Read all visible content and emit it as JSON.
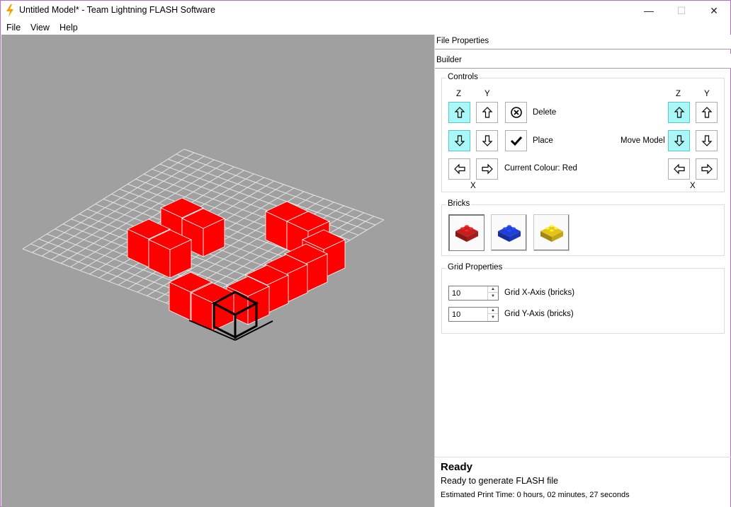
{
  "window": {
    "title": "Untitled Model* - Team Lightning FLASH Software",
    "minimize": "—",
    "maximize": "☐",
    "close": "✕"
  },
  "menu": {
    "items": [
      "File",
      "View",
      "Help"
    ]
  },
  "panel": {
    "file_properties": "File Properties",
    "builder": "Builder"
  },
  "controls": {
    "title": "Controls",
    "z": "Z",
    "y": "Y",
    "x": "X",
    "delete": "Delete",
    "place": "Place",
    "current_colour": "Current Colour: Red",
    "move_model": "Move Model"
  },
  "bricks": {
    "title": "Bricks",
    "items": [
      {
        "name": "red",
        "color": "#c41e1e"
      },
      {
        "name": "blue",
        "color": "#1f3fd6"
      },
      {
        "name": "yellow",
        "color": "#e6c21c"
      }
    ]
  },
  "grid": {
    "title": "Grid Properties",
    "x_value": "10",
    "x_label": "Grid X-Axis (bricks)",
    "y_value": "10",
    "y_label": "Grid Y-Axis (bricks)"
  },
  "status": {
    "heading": "Ready",
    "message": "Ready to generate FLASH file",
    "estimate": "Estimated Print Time: 0 hours, 02 minutes, 27 seconds"
  },
  "colors": {
    "viewport_bg": "#a0a0a0",
    "brick_red": "#ff0000",
    "active_button": "#aaf7f8"
  }
}
